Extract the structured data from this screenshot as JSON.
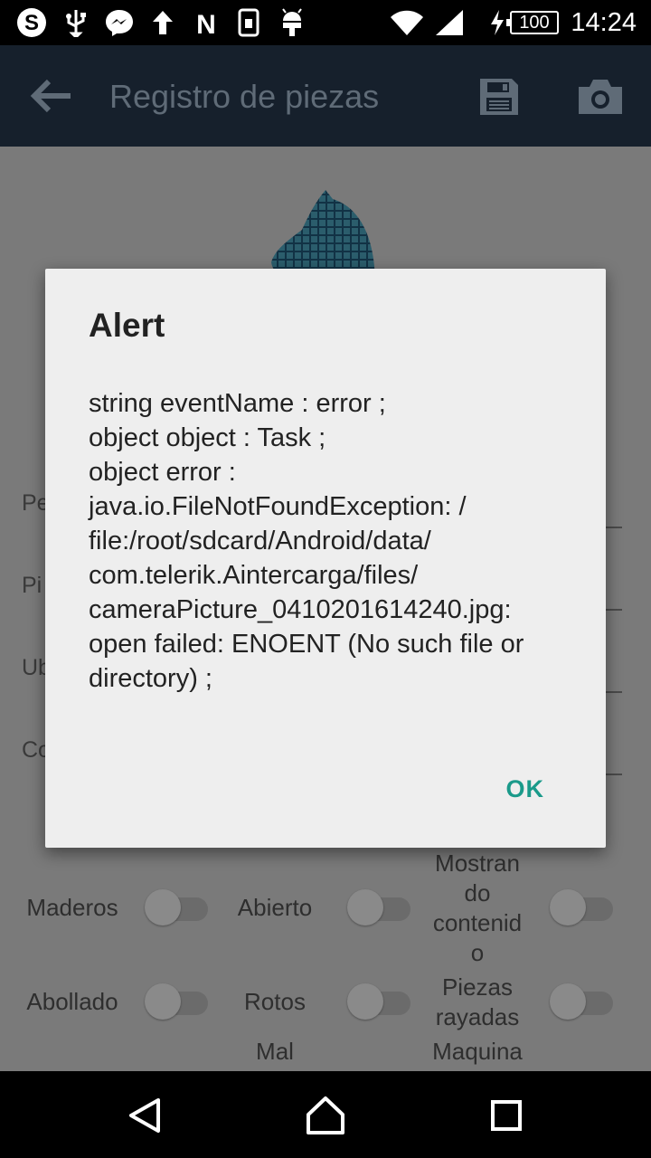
{
  "status_bar": {
    "time": "14:24",
    "battery": "100",
    "icons": [
      "skype-icon",
      "usb-icon",
      "messenger-icon",
      "upload-icon",
      "n-app-icon",
      "sim-card-icon",
      "android-icon",
      "wifi-icon",
      "signal-icon",
      "charging-icon"
    ]
  },
  "app_bar": {
    "title": "Registro de piezas",
    "icons": [
      "back-arrow-icon",
      "save-icon",
      "camera-icon"
    ]
  },
  "form": {
    "labels": [
      "Pe",
      "Pi",
      "Ub",
      "Co"
    ]
  },
  "toggles": [
    {
      "label": "Maderos",
      "on": false
    },
    {
      "label": "Abierto",
      "on": false
    },
    {
      "label": "Mostran\ndo\ncontenid\no",
      "on": false
    },
    {
      "label": "Abollado",
      "on": false
    },
    {
      "label": "Rotos",
      "on": false
    },
    {
      "label": "Piezas\nrayadas",
      "on": false
    },
    {
      "label": "Mal",
      "on": false
    },
    {
      "label": "Maquina",
      "on": false
    }
  ],
  "dialog": {
    "title": "Alert",
    "message": "string eventName : error ;\nobject object : Task ;\nobject error :\njava.io.FileNotFoundException: /\nfile:/root/sdcard/Android/data/\ncom.telerik.Aintercarga/files/\ncameraPicture_0410201614240.jpg:\nopen failed: ENOENT (No such file or\ndirectory) ;",
    "ok_label": "OK"
  },
  "nav_bar": {
    "icons": [
      "back-triangle-icon",
      "home-icon",
      "recents-icon"
    ]
  },
  "colors": {
    "app_bar": "#16202c",
    "dialog_bg": "#eeeeee",
    "accent": "#1a9a8a"
  }
}
